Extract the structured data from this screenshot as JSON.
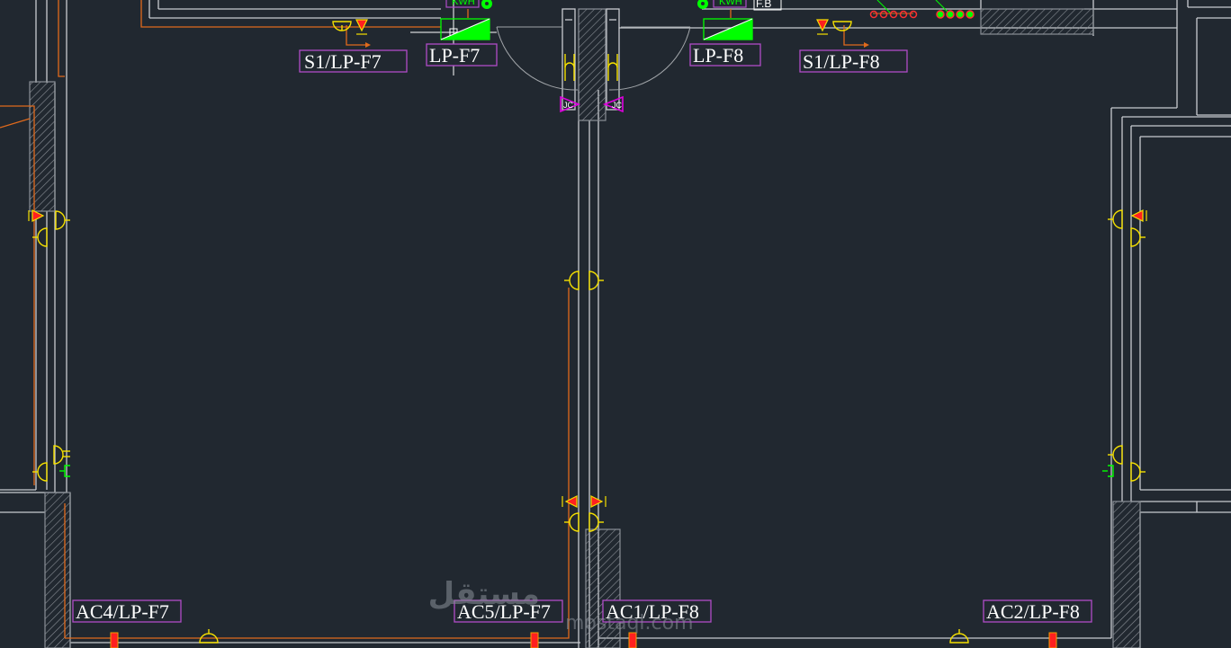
{
  "labels": {
    "s1_f7": "S1/LP-F7",
    "lp_f7": "LP-F7",
    "lp_f8": "LP-F8",
    "s1_f8": "S1/LP-F8",
    "ac4": "AC4/LP-F7",
    "ac5": "AC5/LP-F7",
    "ac1": "AC1/LP-F8",
    "ac2": "AC2/LP-F8",
    "kwh_left": "KWH",
    "kwh_right": "KWH",
    "fb": "F.B"
  },
  "door_tags": {
    "left": "JC",
    "right": "JC"
  },
  "watermark": {
    "arabic": "مستقل",
    "latin": "mostaql.com"
  },
  "colors": {
    "background": "#212830",
    "wall": "#c8ccd0",
    "hatch": "#8a8f96",
    "orange_wire": "#e06a1c",
    "yellow_symbol": "#f5e000",
    "panel_green": "#00ff00",
    "label_border": "#b04cc8",
    "magenta_tag": "#e000e0",
    "red_unit": "#ff2020"
  }
}
